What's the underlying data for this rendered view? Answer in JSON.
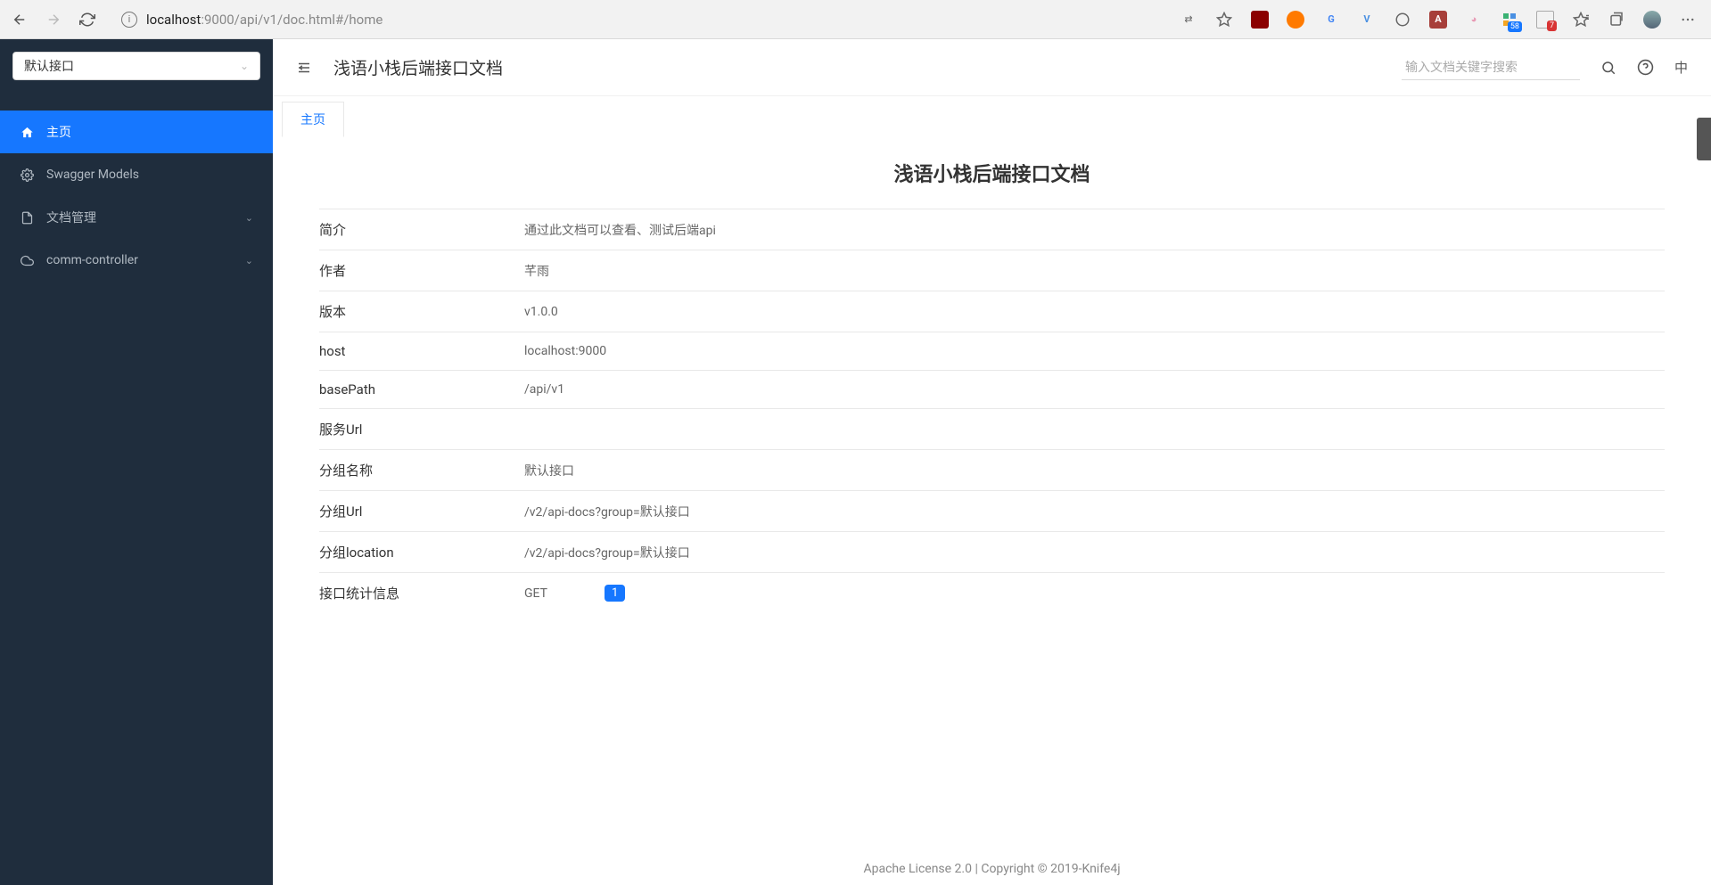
{
  "browser": {
    "url_host": "localhost",
    "url_rest": ":9000/api/v1/doc.html#/home",
    "ext_badge_1": "58",
    "ext_badge_2": "7"
  },
  "sidebar": {
    "select_value": "默认接口",
    "items": [
      {
        "label": "主页",
        "icon": "home-icon"
      },
      {
        "label": "Swagger Models",
        "icon": "model-icon"
      },
      {
        "label": "文档管理",
        "icon": "doc-icon"
      },
      {
        "label": "comm-controller",
        "icon": "cloud-icon"
      }
    ]
  },
  "header": {
    "title": "浅语小栈后端接口文档",
    "search_placeholder": "输入文档关键字搜索",
    "lang": "中"
  },
  "tabs": [
    {
      "label": "主页"
    }
  ],
  "doc": {
    "title": "浅语小栈后端接口文档",
    "rows": {
      "intro_label": "简介",
      "intro_value": "通过此文档可以查看、测试后端api",
      "author_label": "作者",
      "author_value": "芊雨",
      "version_label": "版本",
      "version_value": "v1.0.0",
      "host_label": "host",
      "host_value": "localhost:9000",
      "basePath_label": "basePath",
      "basePath_value": "/api/v1",
      "serviceUrl_label": "服务Url",
      "serviceUrl_value": "",
      "groupName_label": "分组名称",
      "groupName_value": "默认接口",
      "groupUrl_label": "分组Url",
      "groupUrl_value": "/v2/api-docs?group=默认接口",
      "groupLocation_label": "分组location",
      "groupLocation_value": "/v2/api-docs?group=默认接口",
      "stats_label": "接口统计信息",
      "stats_method": "GET",
      "stats_count": "1"
    }
  },
  "footer": {
    "text_prefix": "Apache License 2.0 | Copyright © 2019-",
    "link_text": "Knife4j"
  }
}
